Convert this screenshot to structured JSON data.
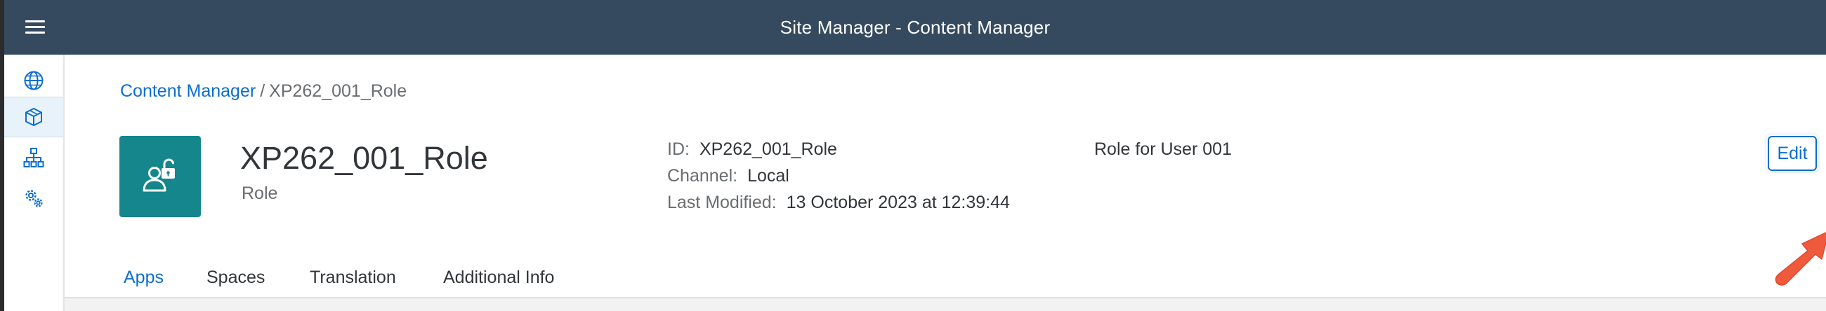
{
  "shellbar": {
    "title": "Site Manager - Content Manager",
    "menu_icon": "hamburger-menu-icon",
    "background_color": "#354a5f"
  },
  "sidenav": {
    "items": [
      {
        "icon": "globe-icon",
        "active": false
      },
      {
        "icon": "cube-icon",
        "active": true
      },
      {
        "icon": "hierarchy-icon",
        "active": false
      },
      {
        "icon": "settings-gears-icon",
        "active": false
      }
    ]
  },
  "breadcrumb": {
    "link": "Content Manager",
    "separator": "/",
    "current": "XP262_001_Role"
  },
  "header": {
    "avatar_icon": "role-unlock-icon",
    "avatar_color": "#14868c",
    "title": "XP262_001_Role",
    "subtitle": "Role",
    "attributes": {
      "id_label": "ID:",
      "id_value": "XP262_001_Role",
      "channel_label": "Channel:",
      "channel_value": "Local",
      "modified_label": "Last Modified:",
      "modified_value": "13 October 2023 at 12:39:44"
    },
    "description": "Role for User 001",
    "edit_label": "Edit"
  },
  "tabs": {
    "items": [
      {
        "label": "Apps",
        "active": true
      },
      {
        "label": "Spaces",
        "active": false
      },
      {
        "label": "Translation",
        "active": false
      },
      {
        "label": "Additional Info",
        "active": false
      }
    ]
  },
  "colors": {
    "accent": "#0a6ed1",
    "annotation_arrow": "#f05a3c"
  }
}
